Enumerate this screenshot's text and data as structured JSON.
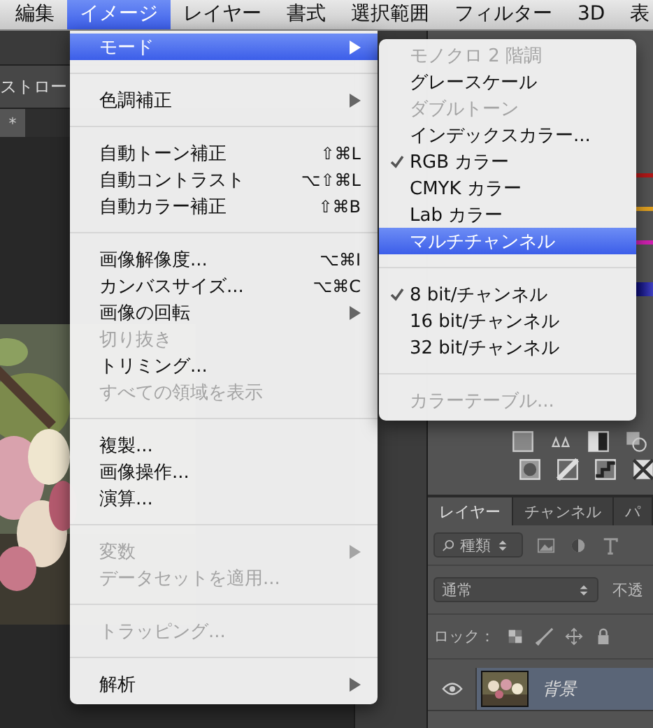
{
  "menu_bar": {
    "items": [
      {
        "label": "編集",
        "selected": false
      },
      {
        "label": "イメージ",
        "selected": true
      },
      {
        "label": "レイヤー",
        "selected": false
      },
      {
        "label": "書式",
        "selected": false
      },
      {
        "label": "選択範囲",
        "selected": false
      },
      {
        "label": "フィルター",
        "selected": false
      },
      {
        "label": "3D",
        "selected": false
      },
      {
        "label": "表",
        "selected": false
      }
    ]
  },
  "options_bar": {
    "label": "ストロー"
  },
  "document_tab": {
    "label": "*"
  },
  "image_menu": {
    "items": [
      {
        "kind": "item",
        "label": "モード",
        "submenu": true,
        "disabled": false,
        "selected": true
      },
      {
        "kind": "separator"
      },
      {
        "kind": "item",
        "label": "色調補正",
        "submenu": true,
        "disabled": false,
        "selected": false
      },
      {
        "kind": "separator"
      },
      {
        "kind": "item",
        "label": "自動トーン補正",
        "shortcut": "⇧⌘L",
        "disabled": false,
        "selected": false
      },
      {
        "kind": "item",
        "label": "自動コントラスト",
        "shortcut": "⌥⇧⌘L",
        "disabled": false,
        "selected": false
      },
      {
        "kind": "item",
        "label": "自動カラー補正",
        "shortcut": "⇧⌘B",
        "disabled": false,
        "selected": false
      },
      {
        "kind": "separator"
      },
      {
        "kind": "item",
        "label": "画像解像度...",
        "shortcut": "⌥⌘I",
        "disabled": false,
        "selected": false
      },
      {
        "kind": "item",
        "label": "カンバスサイズ...",
        "shortcut": "⌥⌘C",
        "disabled": false,
        "selected": false
      },
      {
        "kind": "item",
        "label": "画像の回転",
        "submenu": true,
        "disabled": false,
        "selected": false
      },
      {
        "kind": "item",
        "label": "切り抜き",
        "disabled": true,
        "selected": false
      },
      {
        "kind": "item",
        "label": "トリミング...",
        "disabled": false,
        "selected": false
      },
      {
        "kind": "item",
        "label": "すべての領域を表示",
        "disabled": true,
        "selected": false
      },
      {
        "kind": "separator"
      },
      {
        "kind": "item",
        "label": "複製...",
        "disabled": false,
        "selected": false
      },
      {
        "kind": "item",
        "label": "画像操作...",
        "disabled": false,
        "selected": false
      },
      {
        "kind": "item",
        "label": "演算...",
        "disabled": false,
        "selected": false
      },
      {
        "kind": "separator"
      },
      {
        "kind": "item",
        "label": "変数",
        "submenu": true,
        "disabled": true,
        "selected": false
      },
      {
        "kind": "item",
        "label": "データセットを適用...",
        "disabled": true,
        "selected": false
      },
      {
        "kind": "separator"
      },
      {
        "kind": "item",
        "label": "トラッピング...",
        "disabled": true,
        "selected": false
      },
      {
        "kind": "separator"
      },
      {
        "kind": "item",
        "label": "解析",
        "submenu": true,
        "disabled": false,
        "selected": false
      }
    ]
  },
  "mode_submenu": {
    "items": [
      {
        "kind": "item",
        "label": "モノクロ 2 階調",
        "disabled": true,
        "checked": false,
        "selected": false
      },
      {
        "kind": "item",
        "label": "グレースケール",
        "disabled": false,
        "checked": false,
        "selected": false
      },
      {
        "kind": "item",
        "label": "ダブルトーン",
        "disabled": true,
        "checked": false,
        "selected": false
      },
      {
        "kind": "item",
        "label": "インデックスカラー...",
        "disabled": false,
        "checked": false,
        "selected": false
      },
      {
        "kind": "item",
        "label": "RGB カラー",
        "disabled": false,
        "checked": true,
        "selected": false
      },
      {
        "kind": "item",
        "label": "CMYK カラー",
        "disabled": false,
        "checked": false,
        "selected": false
      },
      {
        "kind": "item",
        "label": "Lab カラー",
        "disabled": false,
        "checked": false,
        "selected": false
      },
      {
        "kind": "item",
        "label": "マルチチャンネル",
        "disabled": false,
        "checked": false,
        "selected": true
      },
      {
        "kind": "separator"
      },
      {
        "kind": "item",
        "label": "8 bit/チャンネル",
        "disabled": false,
        "checked": true,
        "selected": false
      },
      {
        "kind": "item",
        "label": "16 bit/チャンネル",
        "disabled": false,
        "checked": false,
        "selected": false
      },
      {
        "kind": "item",
        "label": "32 bit/チャンネル",
        "disabled": false,
        "checked": false,
        "selected": false
      },
      {
        "kind": "separator"
      },
      {
        "kind": "item",
        "label": "カラーテーブル...",
        "disabled": true,
        "checked": false,
        "selected": false
      }
    ]
  },
  "layers_panel": {
    "tabs": [
      {
        "label": "レイヤー",
        "selected": true
      },
      {
        "label": "チャンネル",
        "selected": false
      },
      {
        "label": "パ",
        "selected": false
      }
    ],
    "filter": "種類",
    "blend_mode": "通常",
    "opacity_label": "不透",
    "lock_label": "ロック：",
    "layers": [
      {
        "name": "背景",
        "selected": true,
        "visible": true
      }
    ]
  }
}
